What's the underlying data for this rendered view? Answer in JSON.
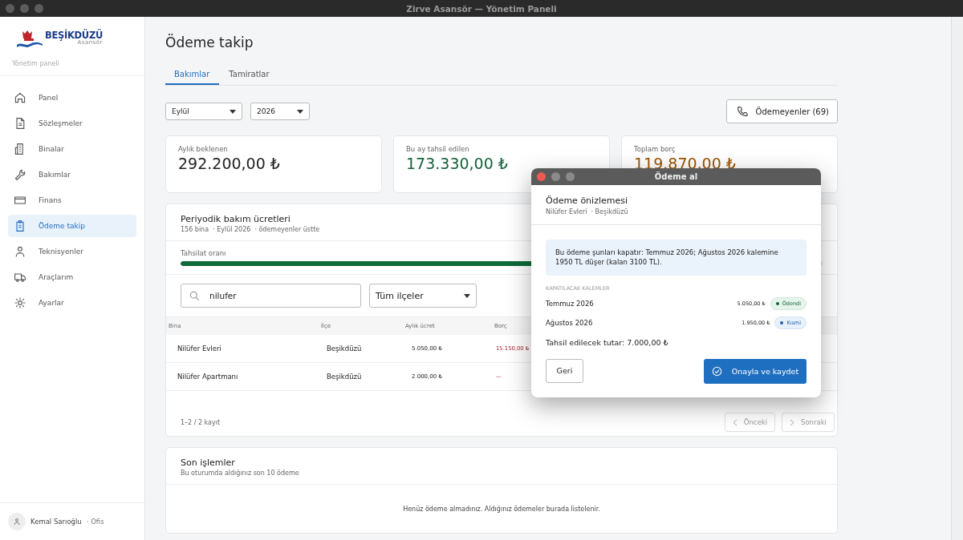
{
  "window": {
    "title": "Zirve Asansör — Yönetim Paneli"
  },
  "sidebar": {
    "logo": {
      "name": "BEŞİKDÜZÜ",
      "sub": "Asansör"
    },
    "caption": "Yönetim paneli",
    "items": [
      {
        "label": "Panel",
        "selected": false
      },
      {
        "label": "Sözleşmeler",
        "selected": false
      },
      {
        "label": "Binalar",
        "selected": false
      },
      {
        "label": "Bakımlar",
        "selected": false
      },
      {
        "label": "Finans",
        "selected": false
      },
      {
        "label": "Ödeme takip",
        "selected": true
      },
      {
        "label": "Teknisyenler",
        "selected": false
      },
      {
        "label": "Araçlarım",
        "selected": false
      },
      {
        "label": "Ayarlar",
        "selected": false
      }
    ],
    "user": {
      "name": "Kemal Sarıoğlu",
      "role": "· Ofis"
    }
  },
  "page": {
    "title": "Ödeme takip",
    "tabs": [
      {
        "label": "Bakımlar",
        "selected": true
      },
      {
        "label": "Tamiratlar",
        "selected": false
      }
    ],
    "filters": {
      "month": "Eylül",
      "year": "2026"
    },
    "unpaid_button": "Ödemeyenler (69)",
    "stats": [
      {
        "label": "Aylık beklenen",
        "value": "292.200,00 ₺",
        "kind": "neutral"
      },
      {
        "label": "Bu ay tahsil edilen",
        "value": "173.330,00 ₺",
        "kind": "good"
      },
      {
        "label": "Toplam borç",
        "value": "119.870,00 ₺",
        "kind": "warn"
      }
    ]
  },
  "fees": {
    "title": "Periyodik bakım ücretleri",
    "meta": [
      "156 bina",
      "· Eylül 2026",
      "· ödemeyenler üstte"
    ],
    "progress": {
      "label": "Tahsilat oranı",
      "level": 0.593
    },
    "search": {
      "value": "nilufer"
    },
    "district": "Tüm ilçeler",
    "columns": [
      "Bina",
      "İlçe",
      "Aylık ücret",
      "Borç"
    ],
    "rows": [
      {
        "bina": "Nilüfer Evleri",
        "ilce": "Beşikdüzü",
        "ucret": "5.050,00 ₺",
        "borc": "15.150,00 ₺"
      },
      {
        "bina": "Nilüfer Apartmanı",
        "ilce": "Beşikdüzü",
        "ucret": "2.000,00 ₺",
        "borc": "—"
      }
    ],
    "count": "1–2 / 2 kayıt",
    "prev": {
      "label": "Önceki",
      "disabled": true
    },
    "next": {
      "label": "Sonraki",
      "disabled": true
    }
  },
  "recent": {
    "title": "Son işlemler",
    "subtitle": "Bu oturumda aldığınız son 10 ödeme",
    "empty": "Henüz ödeme almadınız. Aldığınız ödemeler burada listelenir."
  },
  "dialog": {
    "title": "Ödeme al",
    "heading": "Ödeme önizlemesi",
    "meta": [
      "Nilüfer Evleri",
      "· Beşikdüzü"
    ],
    "notice": "Bu ödeme şunları kapatır: Temmuz 2026; Ağustos 2026 kalemine 1950 TL düşer (kalan 3100 TL).",
    "items_title": "KAPATILACAK KALEMLER",
    "items": [
      {
        "period": "Temmuz 2026",
        "amount": "5.050,00 ₺",
        "status": "Ödendi",
        "kind": "paid"
      },
      {
        "period": "Ağustos 2026",
        "amount": "1.950,00 ₺",
        "status": "Kısmi",
        "kind": "partial"
      }
    ],
    "total": "Tahsil edilecek tutar: 7.000,00 ₺",
    "back": "Geri",
    "confirm": "Onayla ve kaydet"
  }
}
